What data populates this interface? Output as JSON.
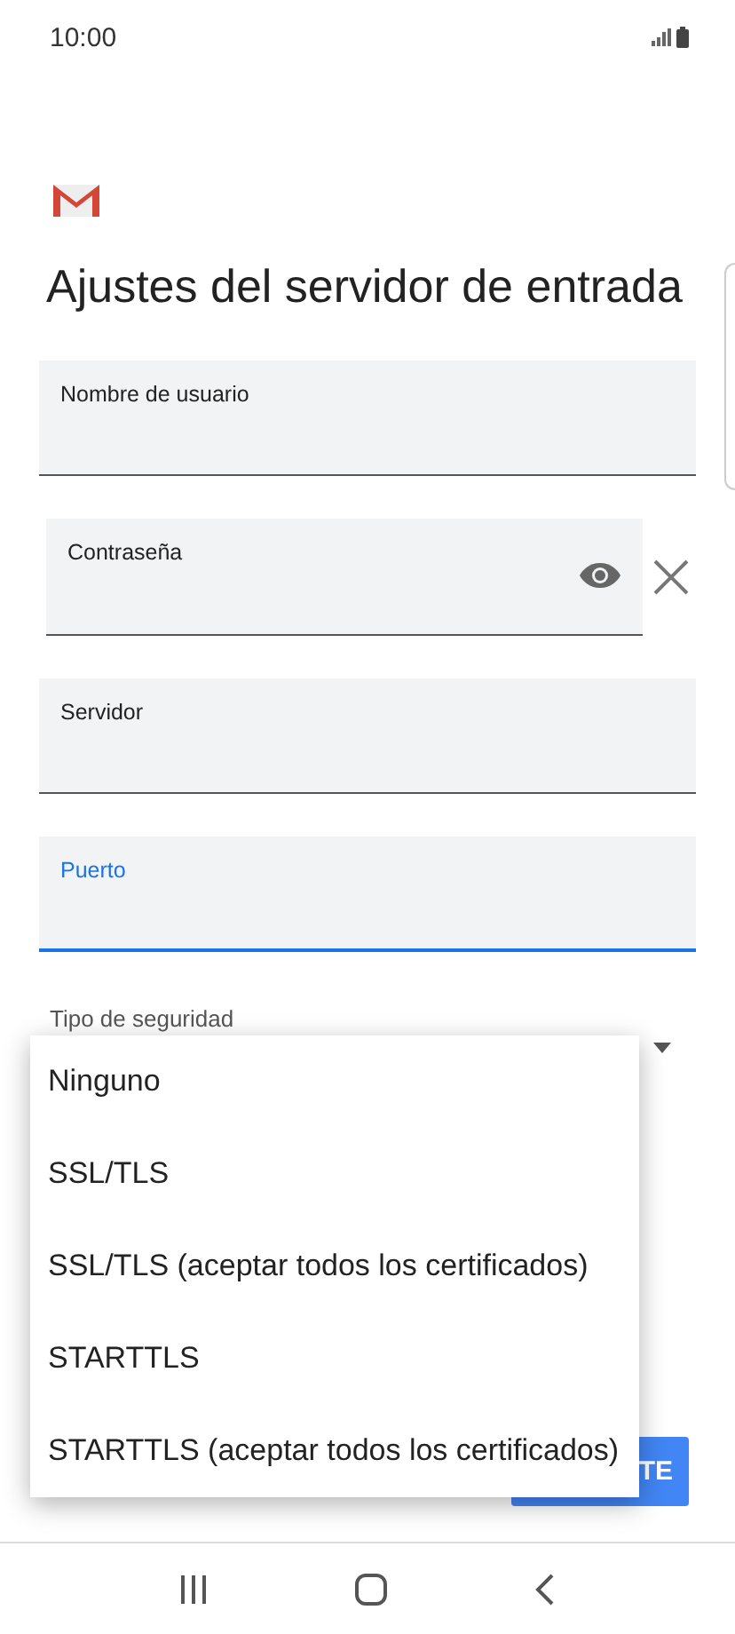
{
  "status_bar": {
    "time": "10:00"
  },
  "title": "Ajustes del servidor de entrada",
  "fields": [
    {
      "label": "Nombre de usuario",
      "kind": "text",
      "focused": false
    },
    {
      "label": "Contraseña",
      "kind": "password",
      "focused": false
    },
    {
      "label": "Servidor",
      "kind": "text",
      "focused": false
    },
    {
      "label": "Puerto",
      "kind": "text",
      "focused": true
    }
  ],
  "security": {
    "label": "Tipo de seguridad"
  },
  "menu": {
    "items": [
      {
        "label": "Ninguno"
      },
      {
        "label": "SSL/TLS"
      },
      {
        "label": "SSL/TLS (aceptar todos los certificados)"
      },
      {
        "label": "STARTTLS"
      },
      {
        "label": "STARTTLS (aceptar todos los certificados)"
      }
    ]
  },
  "button": {
    "label": "TE"
  }
}
